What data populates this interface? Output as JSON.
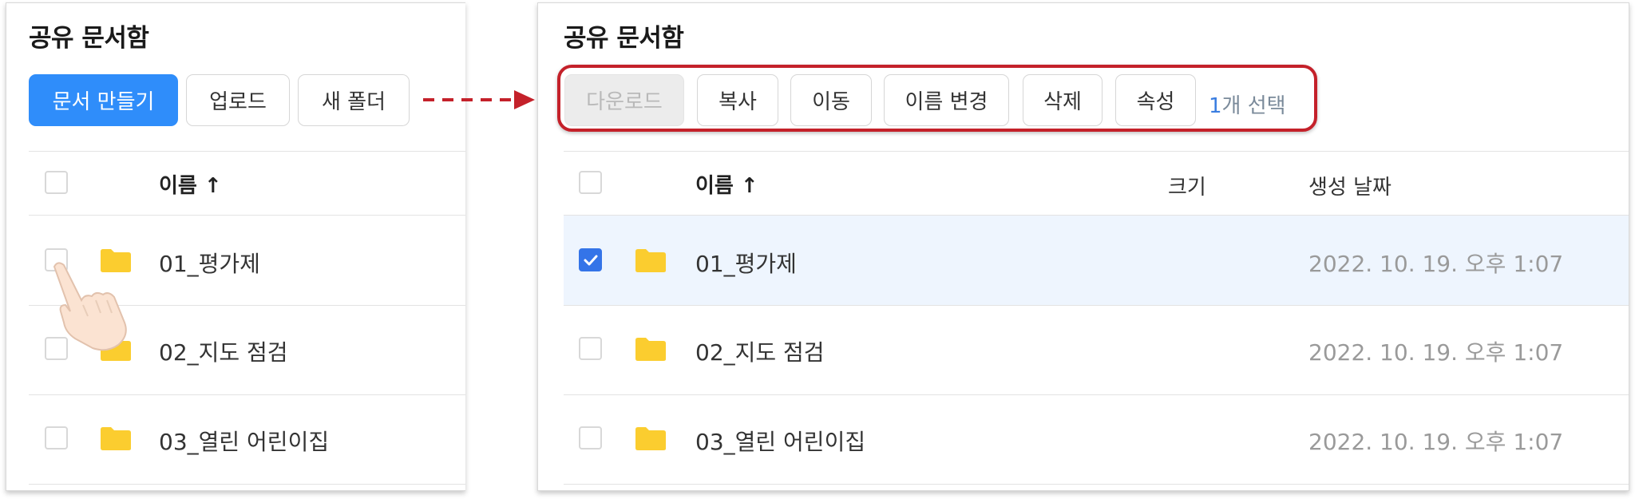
{
  "left_panel": {
    "title": "공유 문서함",
    "buttons": {
      "create_doc": "문서 만들기",
      "upload": "업로드",
      "new_folder": "새 폴더"
    },
    "columns": {
      "name": "이름 ↑"
    },
    "rows": [
      {
        "name": "01_평가제"
      },
      {
        "name": "02_지도 점검"
      },
      {
        "name": "03_열린 어린이집"
      }
    ]
  },
  "right_panel": {
    "title": "공유 문서함",
    "toolbar": {
      "download": "다운로드",
      "copy": "복사",
      "move": "이동",
      "rename": "이름 변경",
      "delete": "삭제",
      "properties": "속성",
      "selection_count_number": "1",
      "selection_count_label": "개 선택"
    },
    "columns": {
      "name": "이름 ↑",
      "size": "크기",
      "created": "생성 날짜"
    },
    "rows": [
      {
        "name": "01_평가제",
        "size": "",
        "created": "2022. 10. 19. 오후 1:07",
        "selected": true
      },
      {
        "name": "02_지도 점검",
        "size": "",
        "created": "2022. 10. 19. 오후 1:07",
        "selected": false
      },
      {
        "name": "03_열린 어린이집",
        "size": "",
        "created": "2022. 10. 19. 오후 1:07",
        "selected": false
      }
    ]
  },
  "colors": {
    "primary_button": "#2f8dfa",
    "checked_checkbox": "#3474e8",
    "selected_row": "#eef5fe",
    "folder": "#fbcd2f",
    "highlight_annotation": "#c4212a"
  },
  "icons": [
    "folder-icon",
    "checkbox-icon",
    "check-icon",
    "pointing-hand-icon",
    "dashed-arrow-icon"
  ]
}
